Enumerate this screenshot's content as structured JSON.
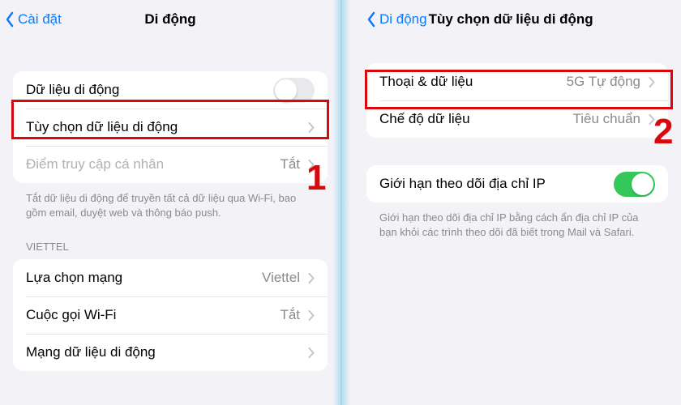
{
  "left": {
    "back_label": "Cài đặt",
    "title": "Di động",
    "group1": {
      "mobile_data_label": "Dữ liệu di động",
      "mobile_data_on": false,
      "options_label": "Tùy chọn dữ liệu di động",
      "hotspot_label": "Điểm truy cập cá nhân",
      "hotspot_value": "Tắt"
    },
    "footer1": "Tắt dữ liệu di động để truyền tất cả dữ liệu qua Wi-Fi, bao gồm email, duyệt web và thông báo push.",
    "section_header": "VIETTEL",
    "group2": {
      "network_selection_label": "Lựa chọn mạng",
      "network_selection_value": "Viettel",
      "wifi_calling_label": "Cuộc gọi Wi-Fi",
      "wifi_calling_value": "Tắt",
      "mobile_data_network_label": "Mạng dữ liệu di động"
    },
    "step": "1"
  },
  "right": {
    "back_label": "Di động",
    "title": "Tùy chọn dữ liệu di động",
    "group1": {
      "voice_data_label": "Thoại & dữ liệu",
      "voice_data_value": "5G Tự động",
      "data_mode_label": "Chế độ dữ liệu",
      "data_mode_value": "Tiêu chuẩn"
    },
    "group2": {
      "limit_ip_label": "Giới hạn theo dõi địa chỉ IP",
      "limit_ip_on": true
    },
    "footer2": "Giới hạn theo dõi địa chỉ IP bằng cách ẩn địa chỉ IP của bạn khỏi các trình theo dõi đã biết trong Mail và Safari.",
    "step": "2"
  }
}
